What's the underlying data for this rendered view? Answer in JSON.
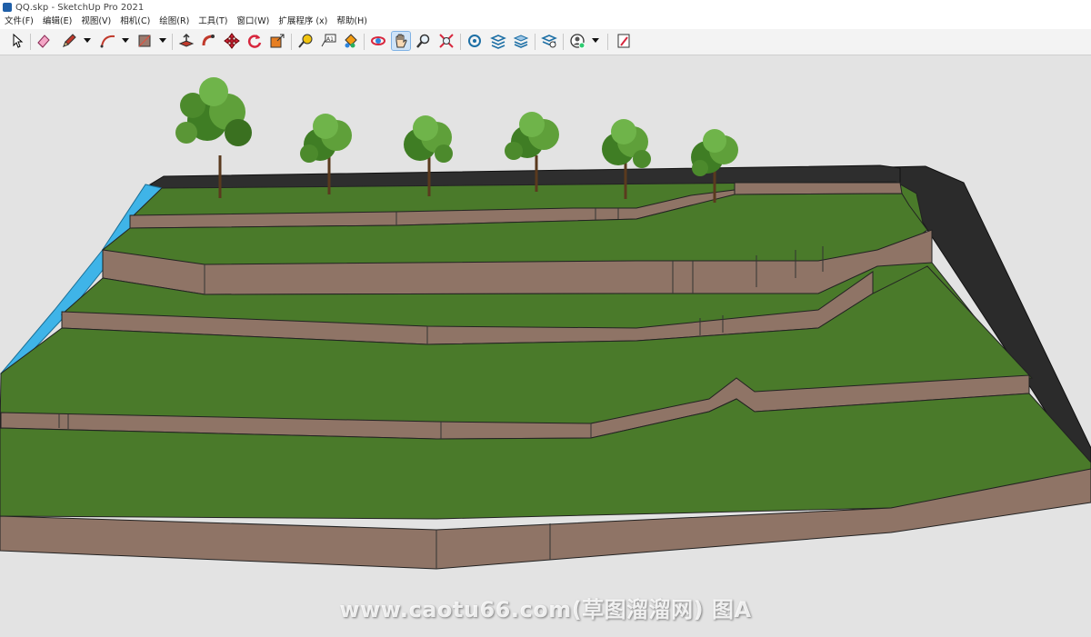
{
  "window": {
    "title": "QQ.skp - SketchUp Pro 2021"
  },
  "menu": [
    "文件(F)",
    "编辑(E)",
    "视图(V)",
    "相机(C)",
    "绘图(R)",
    "工具(T)",
    "窗口(W)",
    "扩展程序 (x)",
    "帮助(H)"
  ],
  "toolbar": {
    "tools": [
      "select-icon",
      "eraser-icon",
      "pencil-icon",
      "arc-icon",
      "rectangle-icon",
      "push-pull-icon",
      "follow-me-icon",
      "move-icon",
      "rotate-icon",
      "scale-icon",
      "tape-measure-icon",
      "text-icon",
      "paint-bucket-icon",
      "orbit-icon",
      "pan-icon",
      "zoom-icon",
      "zoom-extents-icon",
      "3d-warehouse-icon",
      "extension-warehouse-icon",
      "layout-icon",
      "extension-manager-icon",
      "account-icon",
      "model-info-icon"
    ],
    "active_tool": "pan-icon"
  },
  "colors": {
    "grass": "#4a7a2a",
    "retaining_wall": "#8f7466",
    "slope": "#2b2b2b",
    "water": "#3fb4e8",
    "sky": "#e3e3e3"
  },
  "watermark": "www.caotu66.com(草图溜溜网) 图A"
}
